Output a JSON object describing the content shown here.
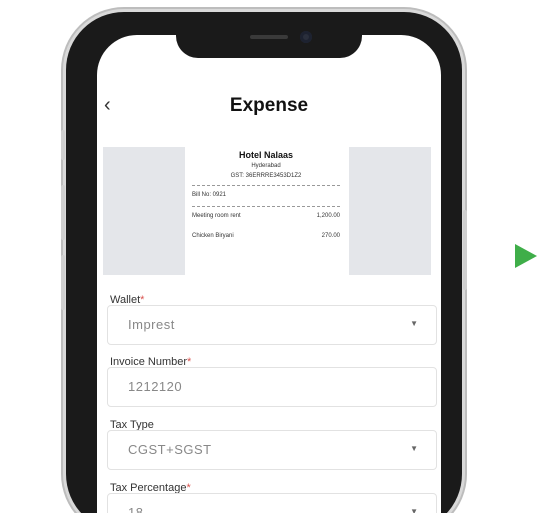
{
  "header": {
    "back_icon": "chevron-left-icon",
    "title": "Expense"
  },
  "receipt": {
    "hotel_name": "Hotel Nalaas",
    "city": "Hyderabad",
    "gst": "GST: 36ERRRE3453D1Z2",
    "bill_no": "Bill No: 0921",
    "items": [
      {
        "name": "Meeting room rent",
        "amount": "1,200.00"
      },
      {
        "name": "Chicken Biryani",
        "amount": "270.00"
      }
    ]
  },
  "form": {
    "wallet": {
      "label": "Wallet",
      "value": "Imprest"
    },
    "invoice_number": {
      "label": "Invoice Number",
      "value": "1212120"
    },
    "tax_type": {
      "label": "Tax Type",
      "value": "CGST+SGST"
    },
    "tax_percentage": {
      "label": "Tax Percentage",
      "value": "18"
    }
  },
  "colors": {
    "accent_play": "#3fae49",
    "required": "#d9534f"
  }
}
